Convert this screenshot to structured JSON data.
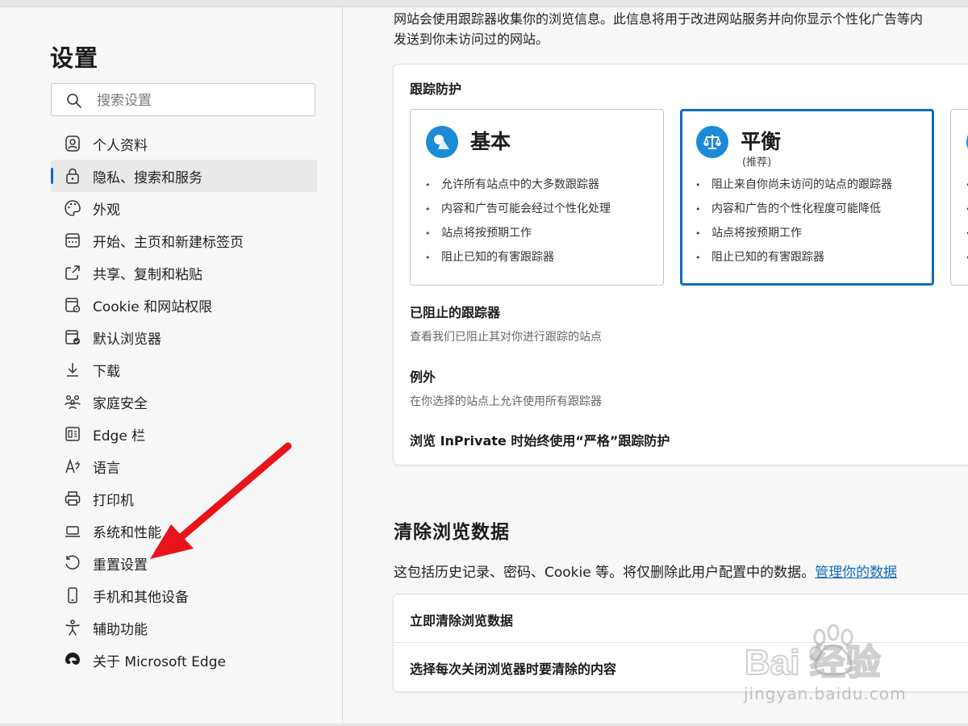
{
  "sidebar": {
    "title": "设置",
    "search_placeholder": "搜索设置",
    "items": [
      {
        "label": "个人资料",
        "icon": "profile-icon"
      },
      {
        "label": "隐私、搜索和服务",
        "icon": "lock-icon",
        "active": true
      },
      {
        "label": "外观",
        "icon": "palette-icon"
      },
      {
        "label": "开始、主页和新建标签页",
        "icon": "home-tabs-icon"
      },
      {
        "label": "共享、复制和粘贴",
        "icon": "share-icon"
      },
      {
        "label": "Cookie 和网站权限",
        "icon": "cookie-permissions-icon"
      },
      {
        "label": "默认浏览器",
        "icon": "default-browser-icon"
      },
      {
        "label": "下载",
        "icon": "download-icon"
      },
      {
        "label": "家庭安全",
        "icon": "family-icon"
      },
      {
        "label": "Edge 栏",
        "icon": "edge-bar-icon"
      },
      {
        "label": "语言",
        "icon": "language-icon"
      },
      {
        "label": "打印机",
        "icon": "printer-icon"
      },
      {
        "label": "系统和性能",
        "icon": "system-icon"
      },
      {
        "label": "重置设置",
        "icon": "reset-icon"
      },
      {
        "label": "手机和其他设备",
        "icon": "phone-icon"
      },
      {
        "label": "辅助功能",
        "icon": "accessibility-icon"
      },
      {
        "label": "关于 Microsoft Edge",
        "icon": "edge-logo-icon"
      }
    ]
  },
  "main": {
    "intro_line1": "网站会使用跟踪器收集你的浏览信息。此信息将用于改进网站服务并向你显示个性化广告等内",
    "intro_line2": "发送到你未访问过的网站。",
    "tracking": {
      "title": "跟踪防护",
      "levels": [
        {
          "name": "基本",
          "icon": "basic-shapes-icon",
          "bullets": [
            "允许所有站点中的大多数跟踪器",
            "内容和广告可能会经过个性化处理",
            "站点将按预期工作",
            "阻止已知的有害跟踪器"
          ]
        },
        {
          "name": "平衡",
          "sub": "(推荐)",
          "icon": "balance-scale-icon",
          "selected": true,
          "bullets": [
            "阻止来自你尚未访问的站点的跟踪器",
            "内容和广告的个性化程度可能降低",
            "站点将按预期工作",
            "阻止已知的有害跟踪器"
          ]
        }
      ],
      "blocked_title": "已阻止的跟踪器",
      "blocked_desc": "查看我们已阻止其对你进行跟踪的站点",
      "exceptions_title": "例外",
      "exceptions_desc": "在你选择的站点上允许使用所有跟踪器",
      "inprivate_title": "浏览 InPrivate 时始终使用“严格”跟踪防护"
    },
    "clear": {
      "title": "清除浏览数据",
      "desc": "这包括历史记录、密码、Cookie 等。将仅删除此用户配置中的数据。",
      "desc_link": "管理你的数据",
      "rows": [
        "立即清除浏览数据",
        "选择每次关闭浏览器时要清除的内容"
      ]
    }
  },
  "watermark": {
    "logo_text": "Bai 经验",
    "url": "jingyan.baidu.com"
  },
  "colors": {
    "accent": "#0f6cbd",
    "icon_blue": "#1d8ad8",
    "annotation_arrow": "#e8141a"
  }
}
